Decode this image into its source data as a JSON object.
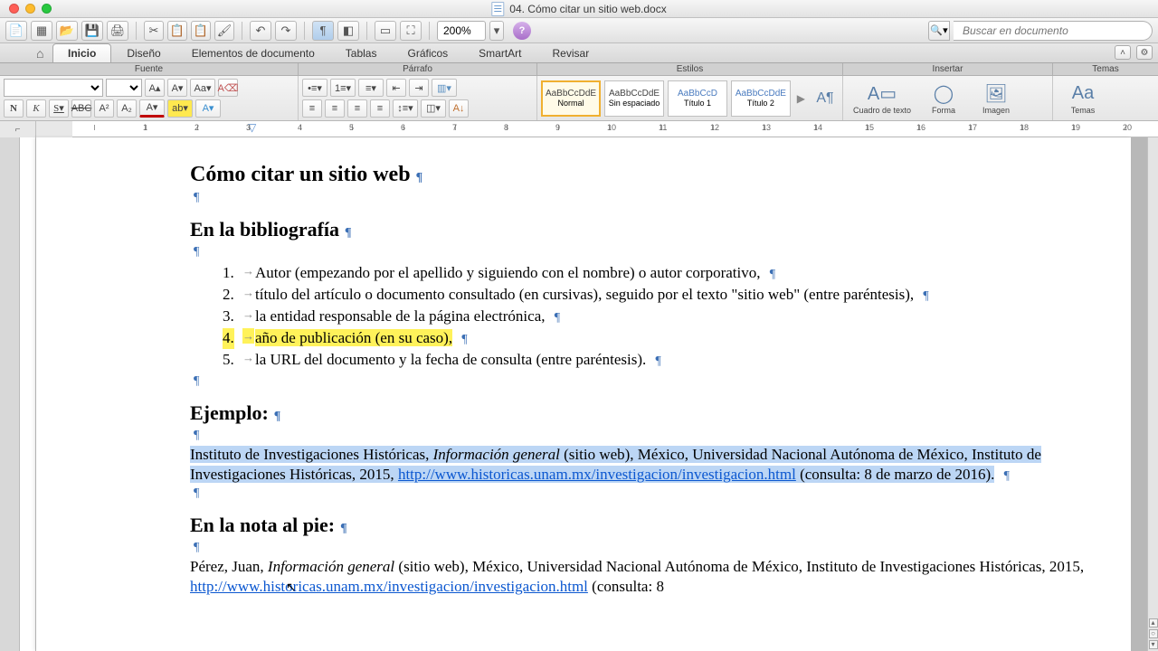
{
  "window": {
    "title": "04. Cómo citar un sitio web.docx"
  },
  "toolbar": {
    "zoom": "200%",
    "search_placeholder": "Buscar en documento"
  },
  "tabs": [
    "Inicio",
    "Diseño",
    "Elementos de documento",
    "Tablas",
    "Gráficos",
    "SmartArt",
    "Revisar"
  ],
  "groups": {
    "fuente": "Fuente",
    "parrafo": "Párrafo",
    "estilos": "Estilos",
    "insertar": "Insertar",
    "temas": "Temas"
  },
  "styles": [
    {
      "preview": "AaBbCcDdE",
      "name": "Normal",
      "sel": true
    },
    {
      "preview": "AaBbCcDdE",
      "name": "Sin espaciado"
    },
    {
      "preview": "AaBbCcD",
      "name": "Título 1",
      "blue": true
    },
    {
      "preview": "AaBbCcDdE",
      "name": "Título 2",
      "blue": true
    }
  ],
  "insert": {
    "textbox": "Cuadro de texto",
    "shape": "Forma",
    "image": "Imagen",
    "themes": "Temas"
  },
  "doc": {
    "title": "Cómo citar un sitio web",
    "h_bib": "En la bibliografía",
    "steps": [
      "Autor (empezando por el apellido y siguiendo con el nombre) o autor corporativo,",
      "título del artículo o documento consultado (en cursivas), seguido por el texto \"sitio web\" (entre paréntesis),",
      "la entidad responsable de la página electrónica,",
      "año de publicación (en su caso),",
      "la URL del documento y la fecha de consulta (entre paréntesis)."
    ],
    "h_ex": "Ejemplo:",
    "ex_part1": "Instituto de Investigaciones Históricas, ",
    "ex_ital": "Información general",
    "ex_part2": " (sitio web), México, Universidad Nacional Autónoma de México, Instituto de Investigaciones Históricas, 2015, ",
    "ex_url": "http://www.historicas.unam.mx/investigacion/investigacion.html",
    "ex_part3": " (consulta: 8 de marzo de 2016).",
    "h_foot": "En la nota al pie:",
    "fn_part1": "Pérez, Juan, ",
    "fn_ital": "Información general",
    "fn_part2": " (sitio web), México, Universidad Nacional Autónoma de México, Instituto de Investigaciones Históricas, 2015, ",
    "fn_url": "http://www.historicas.unam.mx/investigacion/investigacion.html",
    "fn_part3": " (consulta: 8"
  }
}
